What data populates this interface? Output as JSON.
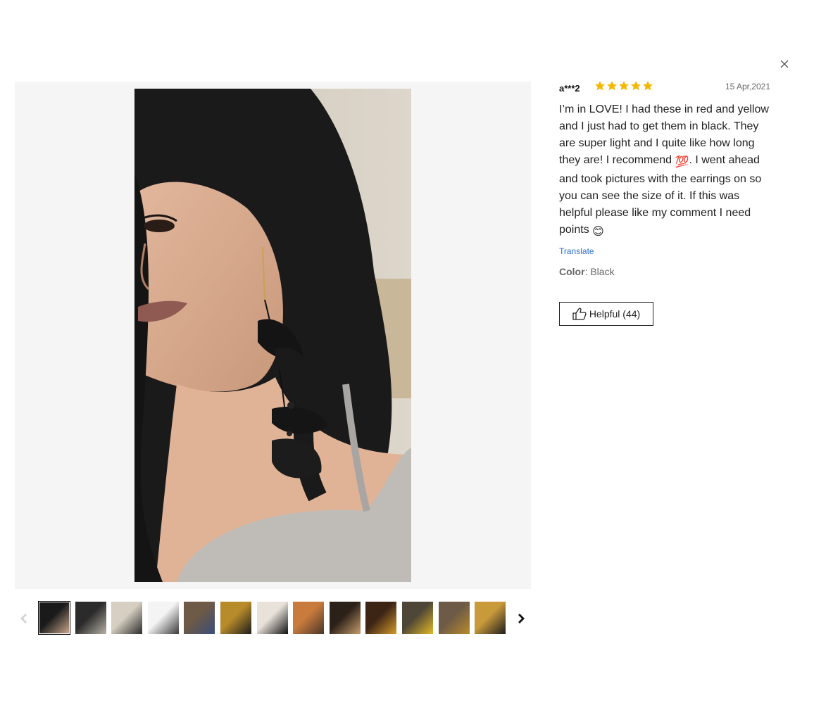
{
  "review": {
    "author": "a***2",
    "rating": 5,
    "date": "15 Apr,2021",
    "text_part1": "I’m in LOVE! I had these in red and yellow and I just had to get them in black. They are super light and I quite like how long they are! I recommend ",
    "emoji_hundred": "💯",
    "text_part2": ". I went ahead and took pictures with the earrings on so you can see the size of it. If this was helpful please like my comment I need points ",
    "emoji_smile": "😊",
    "translate_label": "Translate",
    "color_label": "Color",
    "color_value": ": Black",
    "helpful_label": "Helpful (44)"
  },
  "gallery": {
    "active_index": 0,
    "thumbnails": [
      {
        "name": "selfie-black-earring",
        "colors": [
          "#1a1a1a",
          "#c8a58a"
        ]
      },
      {
        "name": "selfie-side",
        "colors": [
          "#2b2b2b",
          "#b7b2a6"
        ]
      },
      {
        "name": "earring-on-wall",
        "colors": [
          "#d7d0c2",
          "#2a2a2a"
        ]
      },
      {
        "name": "masked-selfie",
        "colors": [
          "#f4f4f4",
          "#3a3a3a"
        ]
      },
      {
        "name": "earrings-collection-1",
        "colors": [
          "#6d5a47",
          "#3a4d7a"
        ]
      },
      {
        "name": "earrings-collection-2",
        "colors": [
          "#b88b2a",
          "#1c1c1c"
        ]
      },
      {
        "name": "black-flower-earring",
        "colors": [
          "#e8e2da",
          "#111111"
        ]
      },
      {
        "name": "orange-hair-selfie",
        "colors": [
          "#c87b3d",
          "#4a3528"
        ]
      },
      {
        "name": "dark-room-selfie",
        "colors": [
          "#2c2119",
          "#c79d6c"
        ]
      },
      {
        "name": "yellow-earring-selfie",
        "colors": [
          "#3d2516",
          "#d49a2b"
        ]
      },
      {
        "name": "yellow-flower-selfie",
        "colors": [
          "#4e4636",
          "#e1b928"
        ]
      },
      {
        "name": "earrings-collection-3",
        "colors": [
          "#6d5a47",
          "#b88b2a"
        ]
      },
      {
        "name": "earrings-collection-4",
        "colors": [
          "#c89a3a",
          "#1c1c1c"
        ]
      }
    ]
  },
  "colors": {
    "star": "#F5B800",
    "link": "#2E6FD1",
    "viewer_bg": "#F5F5F5"
  }
}
